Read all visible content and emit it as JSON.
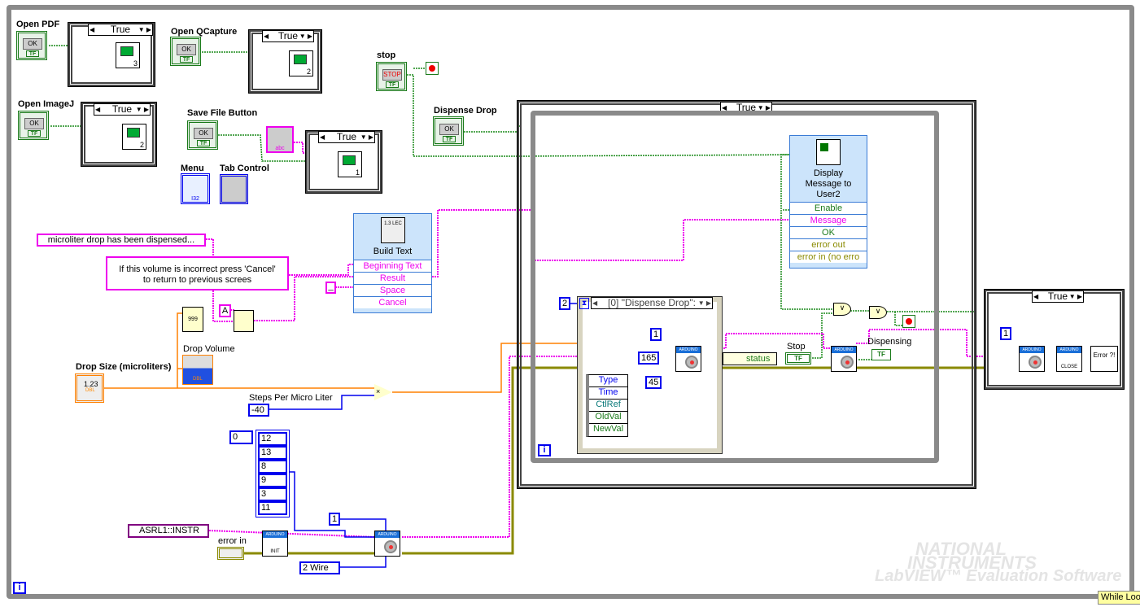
{
  "colors": {
    "boolean_wire": "#1a8a1a",
    "string_wire": "#ee00ee",
    "numeric_wire": "#ff8000",
    "int_wire": "#0000ee",
    "error_wire": "#8a8a00",
    "loop_border": "#8a8a8a"
  },
  "controls": {
    "open_pdf": {
      "label": "Open PDF",
      "button_text": "OK",
      "type": "TF",
      "case": "True",
      "subvi": "3"
    },
    "open_qcapture": {
      "label": "Open QCapture",
      "button_text": "OK",
      "type": "TF",
      "case": "True",
      "subvi": "2"
    },
    "open_imagej": {
      "label": "Open ImageJ",
      "button_text": "OK",
      "type": "TF",
      "case": "True",
      "subvi": "2"
    },
    "save_file": {
      "label": "Save File Button",
      "button_text": "OK",
      "type": "TF",
      "case": "True",
      "subvi": "1",
      "string_array_type": "abc"
    },
    "menu": {
      "label": "Menu",
      "type": "I32"
    },
    "tab_control": {
      "label": "Tab Control"
    },
    "stop": {
      "label": "stop",
      "button_text": "STOP",
      "type": "TF"
    },
    "dispense_drop": {
      "label": "Dispense Drop",
      "button_text": "OK",
      "type": "TF"
    },
    "drop_size": {
      "label": "Drop Size (microliters)",
      "value": "1.23",
      "type": "DBL"
    },
    "drop_volume": {
      "label": "Drop Volume",
      "type": "DBL",
      "scale": [
        "10",
        "5",
        "0"
      ]
    },
    "steps": {
      "label": "Steps Per Micro Liter",
      "value": "-40"
    },
    "pins": {
      "index": "0",
      "values": [
        "12",
        "13",
        "8",
        "9",
        "3",
        "11"
      ]
    },
    "visa": {
      "value": "ASRL1::INSTR"
    },
    "error_in": {
      "label": "error in"
    },
    "init_label": "INIT",
    "close_label": "CLOSE",
    "arduino_label": "ARDUINO",
    "const_1": "1",
    "wire_mode": "2 Wire"
  },
  "strings": {
    "dispensed": "microliter drop has been dispensed...",
    "cancel_msg_1": "If this volume is incorrect press 'Cancel'",
    "cancel_msg_2": "to return to previous screes",
    "dash": "_",
    "a_const": "A",
    "num_fmt": "999"
  },
  "build_text": {
    "title": "Build Text",
    "icon": "1.3 LEC",
    "rows": [
      "Beginning Text",
      "Result",
      "Space",
      "Cancel"
    ]
  },
  "outer_case": {
    "selector": "True"
  },
  "display_message": {
    "title_1": "Display",
    "title_2": "Message to",
    "title_3": "User2",
    "rows": [
      "Enable",
      "Message",
      "OK",
      "error out",
      "error in (no erro"
    ]
  },
  "event_structure": {
    "timeout": "2",
    "selector": "[0] \"Dispense Drop\":",
    "data": [
      "Type",
      "Time",
      "CtlRef",
      "OldVal",
      "NewVal"
    ],
    "consts": [
      "1",
      "165",
      "45"
    ]
  },
  "status_label": "status",
  "stop_local": {
    "label": "Stop",
    "type": "TF"
  },
  "dispensing": {
    "label": "Dispensing",
    "type": "TF"
  },
  "or_symbol": "∨",
  "right_case": {
    "selector": "True",
    "const": "1",
    "error_icon": "Error ?!"
  },
  "iteration": "i",
  "watermark": {
    "line1": "NATIONAL",
    "line2": "INSTRUMENTS",
    "line3": "LabVIEW™ Evaluation Software"
  },
  "tooltip": "While Loo"
}
